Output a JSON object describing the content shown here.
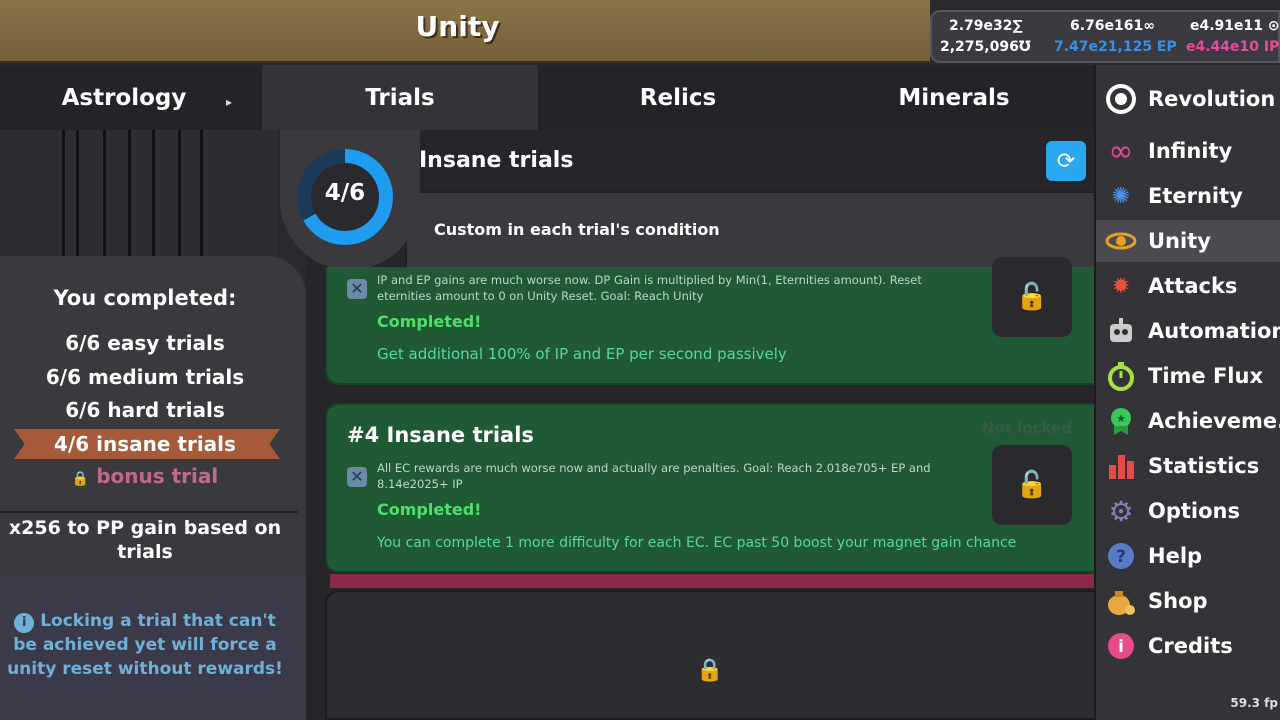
{
  "header": {
    "title": "Unity"
  },
  "currencies": {
    "c1": "2.79e32∑",
    "c2": "6.76e161∞",
    "c3": "e4.91e11 ⊙",
    "c4": "2,275,096Ʊ",
    "c5": "7.47e21,125 EP",
    "c6": "e4.44e10 IP"
  },
  "tabs": [
    {
      "label": "Astrology"
    },
    {
      "label": "Trials"
    },
    {
      "label": "Relics"
    },
    {
      "label": "Minerals"
    }
  ],
  "menu": [
    {
      "label": "Revolution",
      "icon": "revolution-icon",
      "color": "#ffffff"
    },
    {
      "label": "Infinity",
      "icon": "infinity-icon",
      "color": "#e84aa0"
    },
    {
      "label": "Eternity",
      "icon": "eternity-icon",
      "color": "#4a8fe8"
    },
    {
      "label": "Unity",
      "icon": "unity-icon",
      "color": "#e8a020"
    },
    {
      "label": "Attacks",
      "icon": "attacks-icon",
      "color": "#e8503a"
    },
    {
      "label": "Automations",
      "icon": "automations-icon",
      "color": "#cccccc"
    },
    {
      "label": "Time Flux",
      "icon": "time-flux-icon",
      "color": "#a8e040"
    },
    {
      "label": "Achieveme..",
      "icon": "achievement-icon",
      "color": "#3ac85a"
    },
    {
      "label": "Statistics",
      "icon": "statistics-icon",
      "color": "#e84a4a"
    },
    {
      "label": "Options",
      "icon": "options-icon",
      "color": "#8a7ab8"
    },
    {
      "label": "Help",
      "icon": "help-icon",
      "color": "#5a7ac8"
    },
    {
      "label": "Shop",
      "icon": "shop-icon",
      "color": "#e8a840"
    },
    {
      "label": "Credits",
      "icon": "credits-icon",
      "color": "#e84a8a"
    }
  ],
  "fps": "59.3 fp",
  "left_panel": {
    "title": "You completed:",
    "easy": "6/6 easy trials",
    "medium": "6/6 medium trials",
    "hard": "6/6 hard trials",
    "insane": "4/6 insane trials",
    "bonus": "bonus trial",
    "bonus_text": "x256 to PP gain based on trials",
    "note": "Locking a trial that can't be achieved yet will force a unity reset without rewards!"
  },
  "trials": {
    "progress_text": "4/6",
    "progress": 0.6667,
    "title": "Insane trials",
    "condition": "Custom in each trial's condition"
  },
  "cards": [
    {
      "desc": "IP and EP gains are much worse now. DP Gain is multiplied by Min(1, Eternities amount). Reset eternities amount to 0 on Unity Reset. Goal: Reach Unity",
      "status": "Completed!",
      "reward": "Get additional 100% of IP and EP per second passively"
    },
    {
      "title": "#4 Insane trials",
      "lock_state": "Not locked",
      "desc": "All EC rewards are much worse now and actually are penalties. Goal: Reach 2.018e705+ EP and 8.14e2025+ IP",
      "status": "Completed!",
      "reward": "You can complete 1 more difficulty for each EC. EC past 50 boost your magnet gain chance"
    }
  ],
  "colors": {
    "header": "#8a7347",
    "card_green": "#1f5a34",
    "ring_blue": "#1e9cf0",
    "refresh": "#29a8ef",
    "ribbon": "#a65a3a"
  }
}
